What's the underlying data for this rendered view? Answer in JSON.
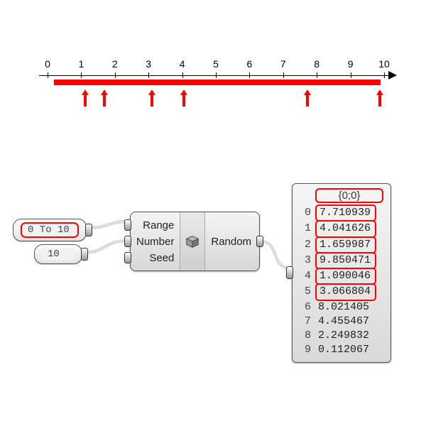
{
  "numberline": {
    "min": 0,
    "max": 10,
    "ticks": [
      0,
      1,
      2,
      3,
      4,
      5,
      6,
      7,
      8,
      9,
      10
    ],
    "red_bar_from": 0.2,
    "red_bar_to": 9.9,
    "red_arrows_at": [
      1.09,
      1.66,
      3.07,
      4.04,
      7.71,
      9.85
    ]
  },
  "inputs": {
    "range_panel": "0 To 10",
    "count_panel": "10"
  },
  "component": {
    "in_ports": [
      "Range",
      "Number",
      "Seed"
    ],
    "out_ports": [
      "Random"
    ],
    "icon_name": "box-icon"
  },
  "output": {
    "header": "{0;0}",
    "rows": [
      {
        "i": 0,
        "v": "7.710939",
        "hl": true
      },
      {
        "i": 1,
        "v": "4.041626",
        "hl": true
      },
      {
        "i": 2,
        "v": "1.659987",
        "hl": true
      },
      {
        "i": 3,
        "v": "9.850471",
        "hl": true
      },
      {
        "i": 4,
        "v": "1.090046",
        "hl": true
      },
      {
        "i": 5,
        "v": "3.066804",
        "hl": true
      },
      {
        "i": 6,
        "v": "8.021405",
        "hl": false
      },
      {
        "i": 7,
        "v": "4.455467",
        "hl": false
      },
      {
        "i": 8,
        "v": "2.249832",
        "hl": false
      },
      {
        "i": 9,
        "v": "0.112067",
        "hl": false
      }
    ]
  }
}
